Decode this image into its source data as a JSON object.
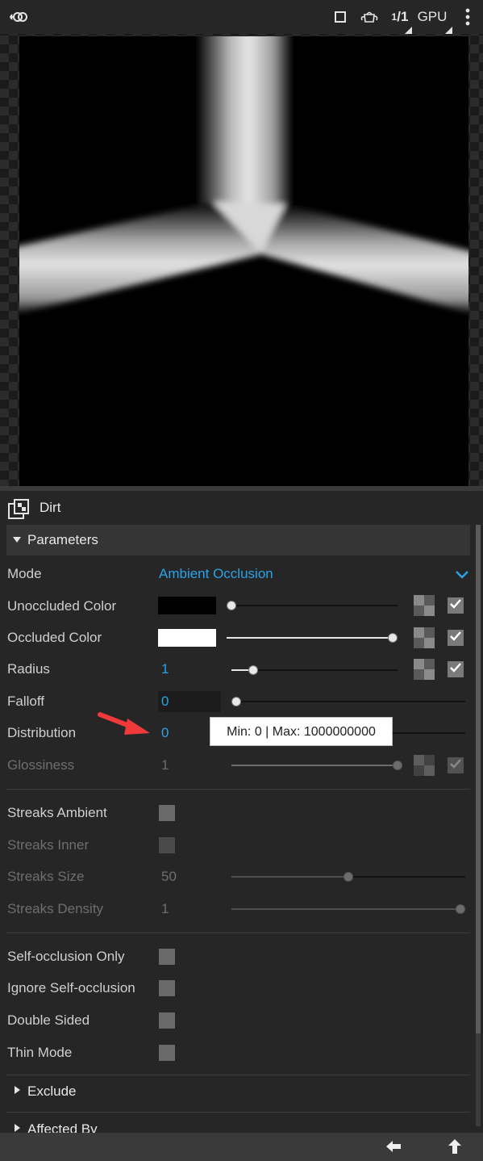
{
  "toolbar": {
    "scale_num": "1",
    "scale_den": "1",
    "device": "GPU"
  },
  "node": {
    "title": "Dirt"
  },
  "parameters": {
    "header": "Parameters",
    "mode": {
      "label": "Mode",
      "value": "Ambient Occlusion"
    },
    "unoccluded_color": {
      "label": "Unoccluded Color",
      "color": "#000000",
      "slider": 0.0,
      "checked": true
    },
    "occluded_color": {
      "label": "Occluded Color",
      "color": "#ffffff",
      "slider": 1.0,
      "checked": true
    },
    "radius": {
      "label": "Radius",
      "value": "1",
      "slider": 0.13,
      "checked": true
    },
    "falloff": {
      "label": "Falloff",
      "value": "0",
      "slider": 0.0
    },
    "distribution": {
      "label": "Distribution",
      "value": "0",
      "slider": 0.0
    },
    "glossiness": {
      "label": "Glossiness",
      "value": "1",
      "slider": 1.0,
      "checked": true
    },
    "streaks_ambient": {
      "label": "Streaks Ambient",
      "checked": false
    },
    "streaks_inner": {
      "label": "Streaks Inner",
      "checked": false
    },
    "streaks_size": {
      "label": "Streaks Size",
      "value": "50",
      "slider": 0.5
    },
    "streaks_density": {
      "label": "Streaks Density",
      "value": "1",
      "slider": 1.0
    },
    "self_occlusion_only": {
      "label": "Self-occlusion Only",
      "checked": false
    },
    "ignore_self_occlusion": {
      "label": "Ignore Self-occlusion",
      "checked": false
    },
    "double_sided": {
      "label": "Double Sided",
      "checked": false
    },
    "thin_mode": {
      "label": "Thin Mode",
      "checked": false
    }
  },
  "tooltip": {
    "text": "Min: 0 | Max: 1000000000"
  },
  "sections": {
    "exclude": "Exclude",
    "affected_by": "Affected By"
  },
  "colors": {
    "accent": "#2aa3e8",
    "annotation_arrow": "#f0393b"
  },
  "icons": [
    "node-link-icon",
    "region-icon",
    "teapot-icon",
    "more-vert-icon",
    "texture-icon",
    "checkmark-icon",
    "chevron-down-icon",
    "arrow-left-icon",
    "arrow-up-icon"
  ]
}
